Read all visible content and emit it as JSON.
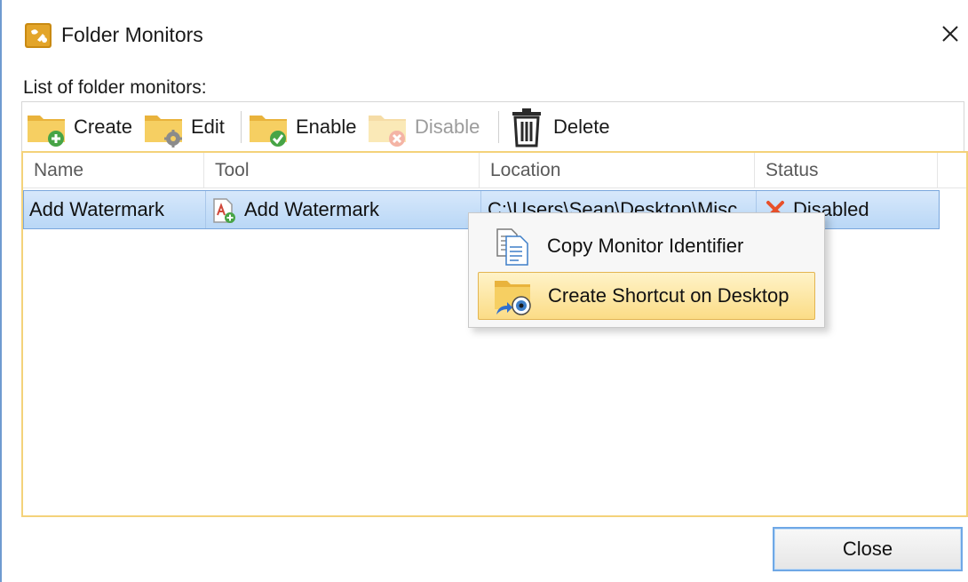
{
  "window": {
    "title": "Folder Monitors",
    "close_glyph": "✕"
  },
  "list_caption": "List of folder monitors:",
  "toolbar": {
    "create": "Create",
    "edit": "Edit",
    "enable": "Enable",
    "disable": "Disable",
    "delete": "Delete"
  },
  "columns": [
    "Name",
    "Tool",
    "Location",
    "Status"
  ],
  "rows": [
    {
      "name": "Add Watermark",
      "tool": "Add Watermark",
      "location": "C:\\Users\\Sean\\Desktop\\Misc",
      "status": "Disabled",
      "selected": true
    }
  ],
  "context_menu": {
    "items": [
      {
        "label": "Copy Monitor Identifier",
        "icon": "copy-document-icon"
      },
      {
        "label": "Create Shortcut on Desktop",
        "icon": "folder-shortcut-icon",
        "highlighted": true
      }
    ]
  },
  "buttons": {
    "close": "Close"
  },
  "colors": {
    "selection": "#b9d7f6",
    "list_border": "#f4d27a",
    "menu_highlight": "#fbdc86",
    "folder": "#f2c24e",
    "green_badge": "#4caf50",
    "red_status": "#e8502a"
  }
}
